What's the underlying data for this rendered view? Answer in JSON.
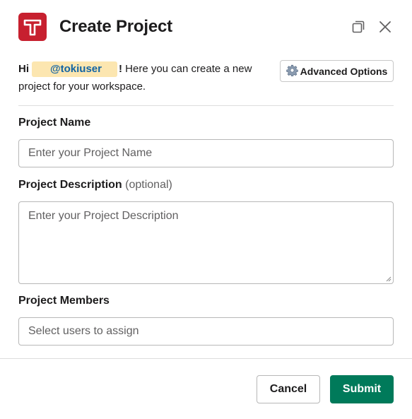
{
  "modal": {
    "title": "Create Project",
    "logo_icon": "tokiu-t-logo-icon",
    "expand_icon": "copy-window-icon",
    "close_icon": "close-icon"
  },
  "intro": {
    "greeting": "Hi",
    "mention": "@tokiuser",
    "exclaim": "!",
    "text": " Here you can create a new project for your workspace."
  },
  "advanced_options": {
    "icon": "gear-icon",
    "label": "Advanced Options"
  },
  "form": {
    "project_name": {
      "label": "Project Name",
      "placeholder": "Enter your Project Name"
    },
    "project_description": {
      "label": "Project Description",
      "optional": "(optional)",
      "placeholder": "Enter your Project Description"
    },
    "project_members": {
      "label": "Project Members",
      "placeholder": "Select users to assign"
    }
  },
  "footer": {
    "cancel_label": "Cancel",
    "submit_label": "Submit"
  },
  "colors": {
    "brand_red": "#c7202f",
    "submit_green": "#007a5a",
    "mention_bg": "#fce6b0",
    "mention_text": "#1264a3"
  }
}
